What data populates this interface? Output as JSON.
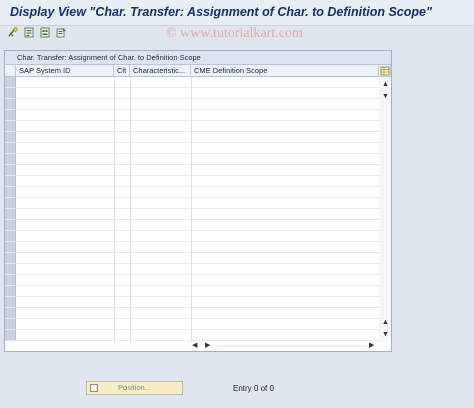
{
  "window": {
    "title": "Display View \"Char. Transfer: Assignment of Char. to Definition Scope\"",
    "watermark": "© www.tutorialkart.com"
  },
  "toolbar": {
    "icons": [
      "glasses-icon",
      "details-icon",
      "navigate-icon",
      "export-icon"
    ]
  },
  "table": {
    "title": "Char. Transfer: Assignment of Char. to Definition Scope",
    "columns": [
      "SAP System ID",
      "Clt",
      "Characteristic...",
      "CME Definition Scope"
    ],
    "rows": [],
    "empty_rows": 24
  },
  "footer": {
    "position_label": "Position...",
    "entry_text": "Entry 0 of 0"
  }
}
